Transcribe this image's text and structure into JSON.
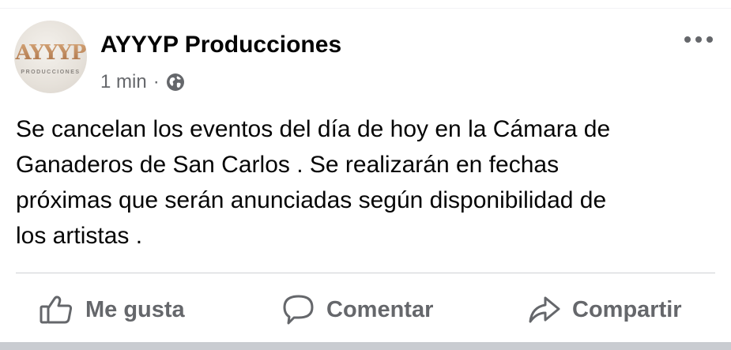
{
  "post": {
    "page_name": "AYYYP Producciones",
    "avatar_text": "AYYYP",
    "avatar_subtext": "PRODUCCIONES",
    "time": "1 min",
    "separator": "·",
    "privacy_icon": "globe-icon",
    "more_icon": "more-options-icon",
    "text_lines": [
      "Se cancelan los eventos del día de hoy en la Cámara de",
      "Ganaderos de San Carlos . Se realizarán en fechas",
      "próximas que serán anunciadas según disponibilidad de",
      "los artistas ."
    ]
  },
  "actions": {
    "like": {
      "label": "Me gusta",
      "icon": "thumbs-up-icon"
    },
    "comment": {
      "label": "Comentar",
      "icon": "comment-bubble-icon"
    },
    "share": {
      "label": "Compartir",
      "icon": "share-arrow-icon"
    }
  },
  "colors": {
    "text": "#050505",
    "secondary": "#65676b",
    "divider": "#ced0d4",
    "avatar_accent": "#b8895a"
  }
}
